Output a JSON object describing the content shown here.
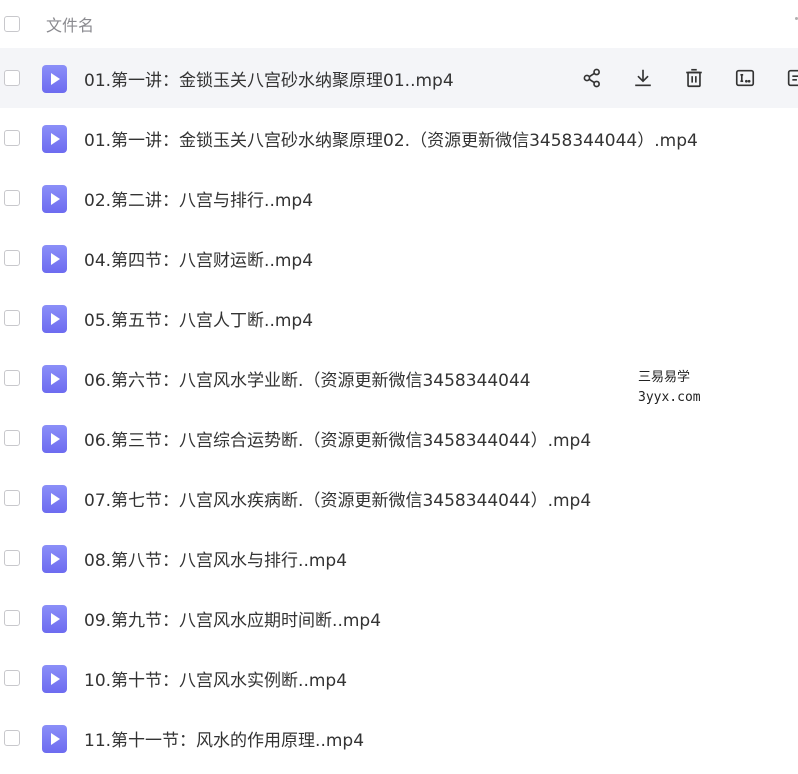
{
  "header": {
    "column_label": "文件名"
  },
  "files": [
    {
      "name": "01.第一讲：金锁玉关八宫砂水纳聚原理01..mp4"
    },
    {
      "name": "01.第一讲：金锁玉关八宫砂水纳聚原理02.（资源更新微信3458344044）.mp4"
    },
    {
      "name": "02.第二讲：八宫与排行..mp4"
    },
    {
      "name": "04.第四节：八宫财运断..mp4"
    },
    {
      "name": "05.第五节：八宫人丁断..mp4"
    },
    {
      "name": "06.第六节：八宫风水学业断.（资源更新微信3458344044"
    },
    {
      "name": "06.第三节：八宫综合运势断.（资源更新微信3458344044）.mp4"
    },
    {
      "name": "07.第七节：八宫风水疾病断.（资源更新微信3458344044）.mp4"
    },
    {
      "name": "08.第八节：八宫风水与排行..mp4"
    },
    {
      "name": "09.第九节：八宫风水应期时间断..mp4"
    },
    {
      "name": "10.第十节：八宫风水实例断..mp4"
    },
    {
      "name": "11.第十一节：风水的作用原理..mp4"
    }
  ],
  "row_actions": [
    "share-icon",
    "download-icon",
    "delete-icon",
    "rename-icon",
    "more-icon"
  ],
  "watermark": {
    "line1": "三易易学",
    "line2": "3yyx.com"
  },
  "colors": {
    "file_icon": "#7b7df5",
    "highlight_row": "#f4f5f8",
    "text": "#333333",
    "header_text": "#8a8a8f"
  }
}
